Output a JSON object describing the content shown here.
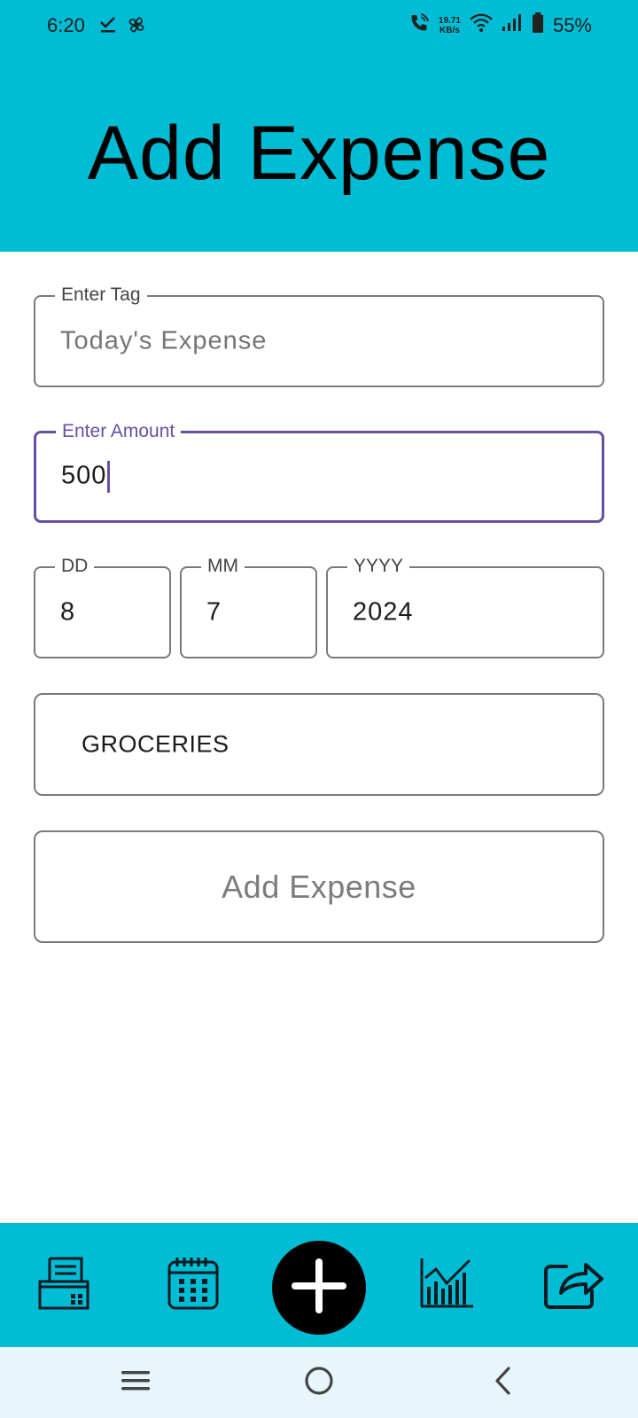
{
  "status_bar": {
    "time": "6:20",
    "left_icons": [
      "check-download-icon",
      "pinwheel-icon"
    ],
    "network_speed_value": "19.71",
    "network_speed_unit": "KB/s",
    "battery_percent": "55%"
  },
  "header": {
    "title": "Add Expense"
  },
  "form": {
    "tag": {
      "label": "Enter Tag",
      "placeholder": "Today's Expense",
      "value": ""
    },
    "amount": {
      "label": "Enter Amount",
      "value": "500",
      "focused": true
    },
    "date": {
      "day": {
        "label": "DD",
        "value": "8"
      },
      "month": {
        "label": "MM",
        "value": "7"
      },
      "year": {
        "label": "YYYY",
        "value": "2024"
      }
    },
    "category": {
      "selected": "GROCERIES"
    },
    "submit_label": "Add Expense"
  },
  "bottom_nav": {
    "items": [
      {
        "icon": "expense-list-icon"
      },
      {
        "icon": "calendar-icon"
      },
      {
        "icon": "add-icon",
        "selected": true
      },
      {
        "icon": "stats-chart-icon"
      },
      {
        "icon": "share-export-icon"
      }
    ]
  },
  "system_nav": {
    "buttons": [
      "menu-icon",
      "home-icon",
      "back-icon"
    ]
  },
  "colors": {
    "primary": "#00BCD4",
    "focus": "#6750A4",
    "fab": "#000000",
    "system_nav_bg": "#E6F6FA"
  }
}
